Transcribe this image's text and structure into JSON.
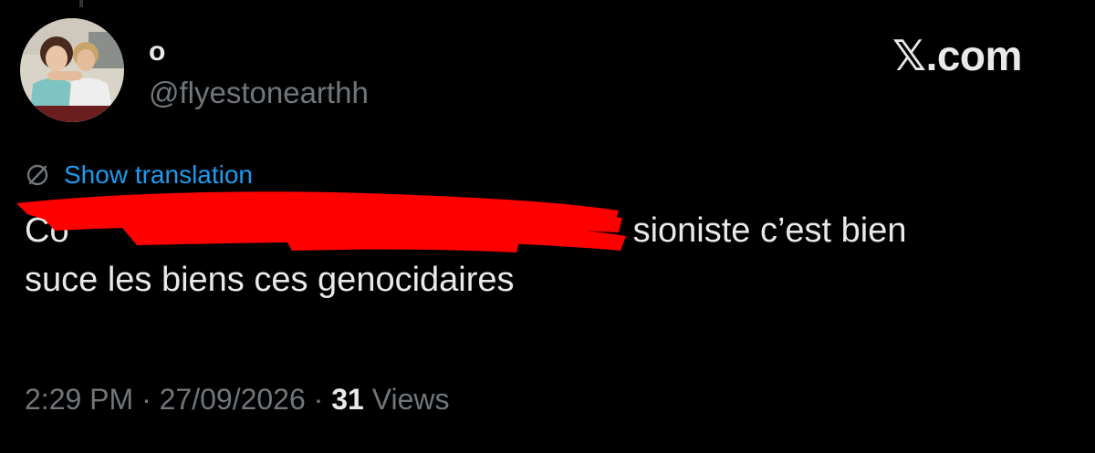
{
  "user": {
    "display_name": "o",
    "handle": "@flyestonearthh"
  },
  "brand": {
    "x_glyph": "𝕏",
    "domain": ".com"
  },
  "translation": {
    "icon": "globe-slash-icon",
    "label": "Show translation"
  },
  "tweet": {
    "line1_visible_start": "Co",
    "line1_visible_end": "sioniste c’est bien",
    "line2": "suce les biens ces genocidaires"
  },
  "meta": {
    "time": "2:29 PM",
    "separator1": " · ",
    "date": "27/09/2026",
    "separator2": " · ",
    "views_count": "31",
    "views_label": " Views"
  },
  "colors": {
    "background": "#000000",
    "text": "#e7e9ea",
    "muted": "#71767b",
    "link": "#1d9bf0",
    "redaction": "#ff0000"
  }
}
